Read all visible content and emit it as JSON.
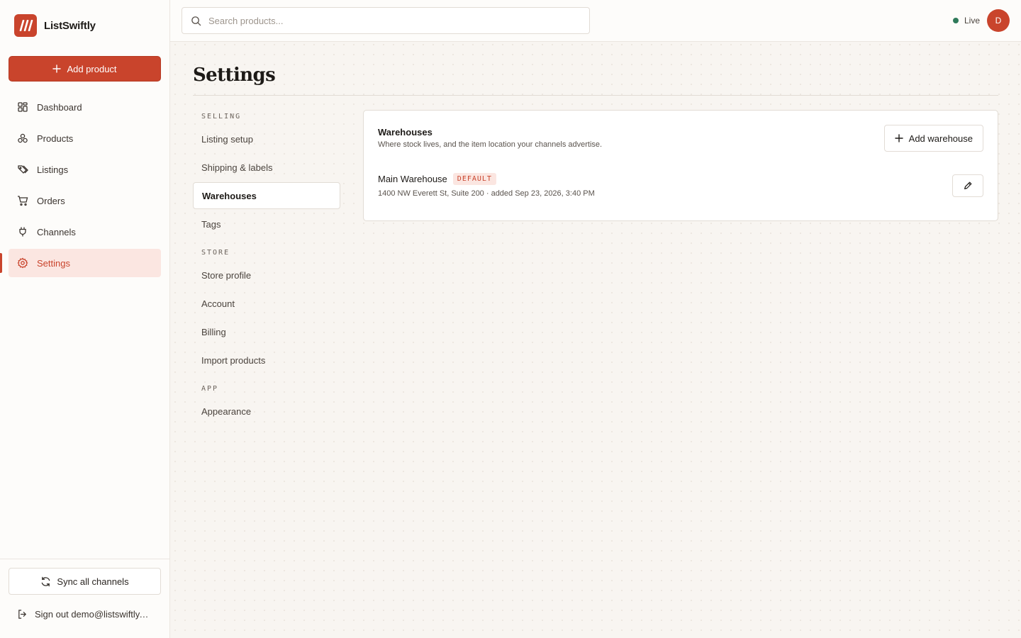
{
  "app": {
    "name": "ListSwiftly"
  },
  "sidebar": {
    "add_product_label": "Add product",
    "items": [
      {
        "label": "Dashboard",
        "icon": "dashboard-icon"
      },
      {
        "label": "Products",
        "icon": "products-icon"
      },
      {
        "label": "Listings",
        "icon": "tag-icon"
      },
      {
        "label": "Orders",
        "icon": "cart-icon"
      },
      {
        "label": "Channels",
        "icon": "plug-icon"
      },
      {
        "label": "Settings",
        "icon": "gear-icon",
        "active": true
      }
    ],
    "sync_label": "Sync all channels",
    "signout_label": "Sign out demo@listswiftly.com"
  },
  "topbar": {
    "search_placeholder": "Search products...",
    "status_label": "Live",
    "status_color": "#2f7a5a",
    "avatar_initial": "D"
  },
  "page": {
    "title": "Settings"
  },
  "subnav": {
    "sections": [
      {
        "heading": "SELLING",
        "items": [
          "Listing setup",
          "Shipping & labels",
          "Warehouses",
          "Tags"
        ]
      },
      {
        "heading": "STORE",
        "items": [
          "Store profile",
          "Account",
          "Billing",
          "Import products"
        ]
      },
      {
        "heading": "APP",
        "items": [
          "Appearance"
        ]
      }
    ],
    "active": "Warehouses"
  },
  "warehouses": {
    "title": "Warehouses",
    "subtitle": "Where stock lives, and the item location your channels advertise.",
    "add_label": "Add warehouse",
    "items": [
      {
        "name": "Main Warehouse",
        "badge": "DEFAULT",
        "meta": "1400 NW Everett St, Suite 200 · added Sep 23, 2026, 3:40 PM"
      }
    ]
  },
  "colors": {
    "accent": "#c9442c",
    "accent_soft": "#fbe6e1"
  }
}
